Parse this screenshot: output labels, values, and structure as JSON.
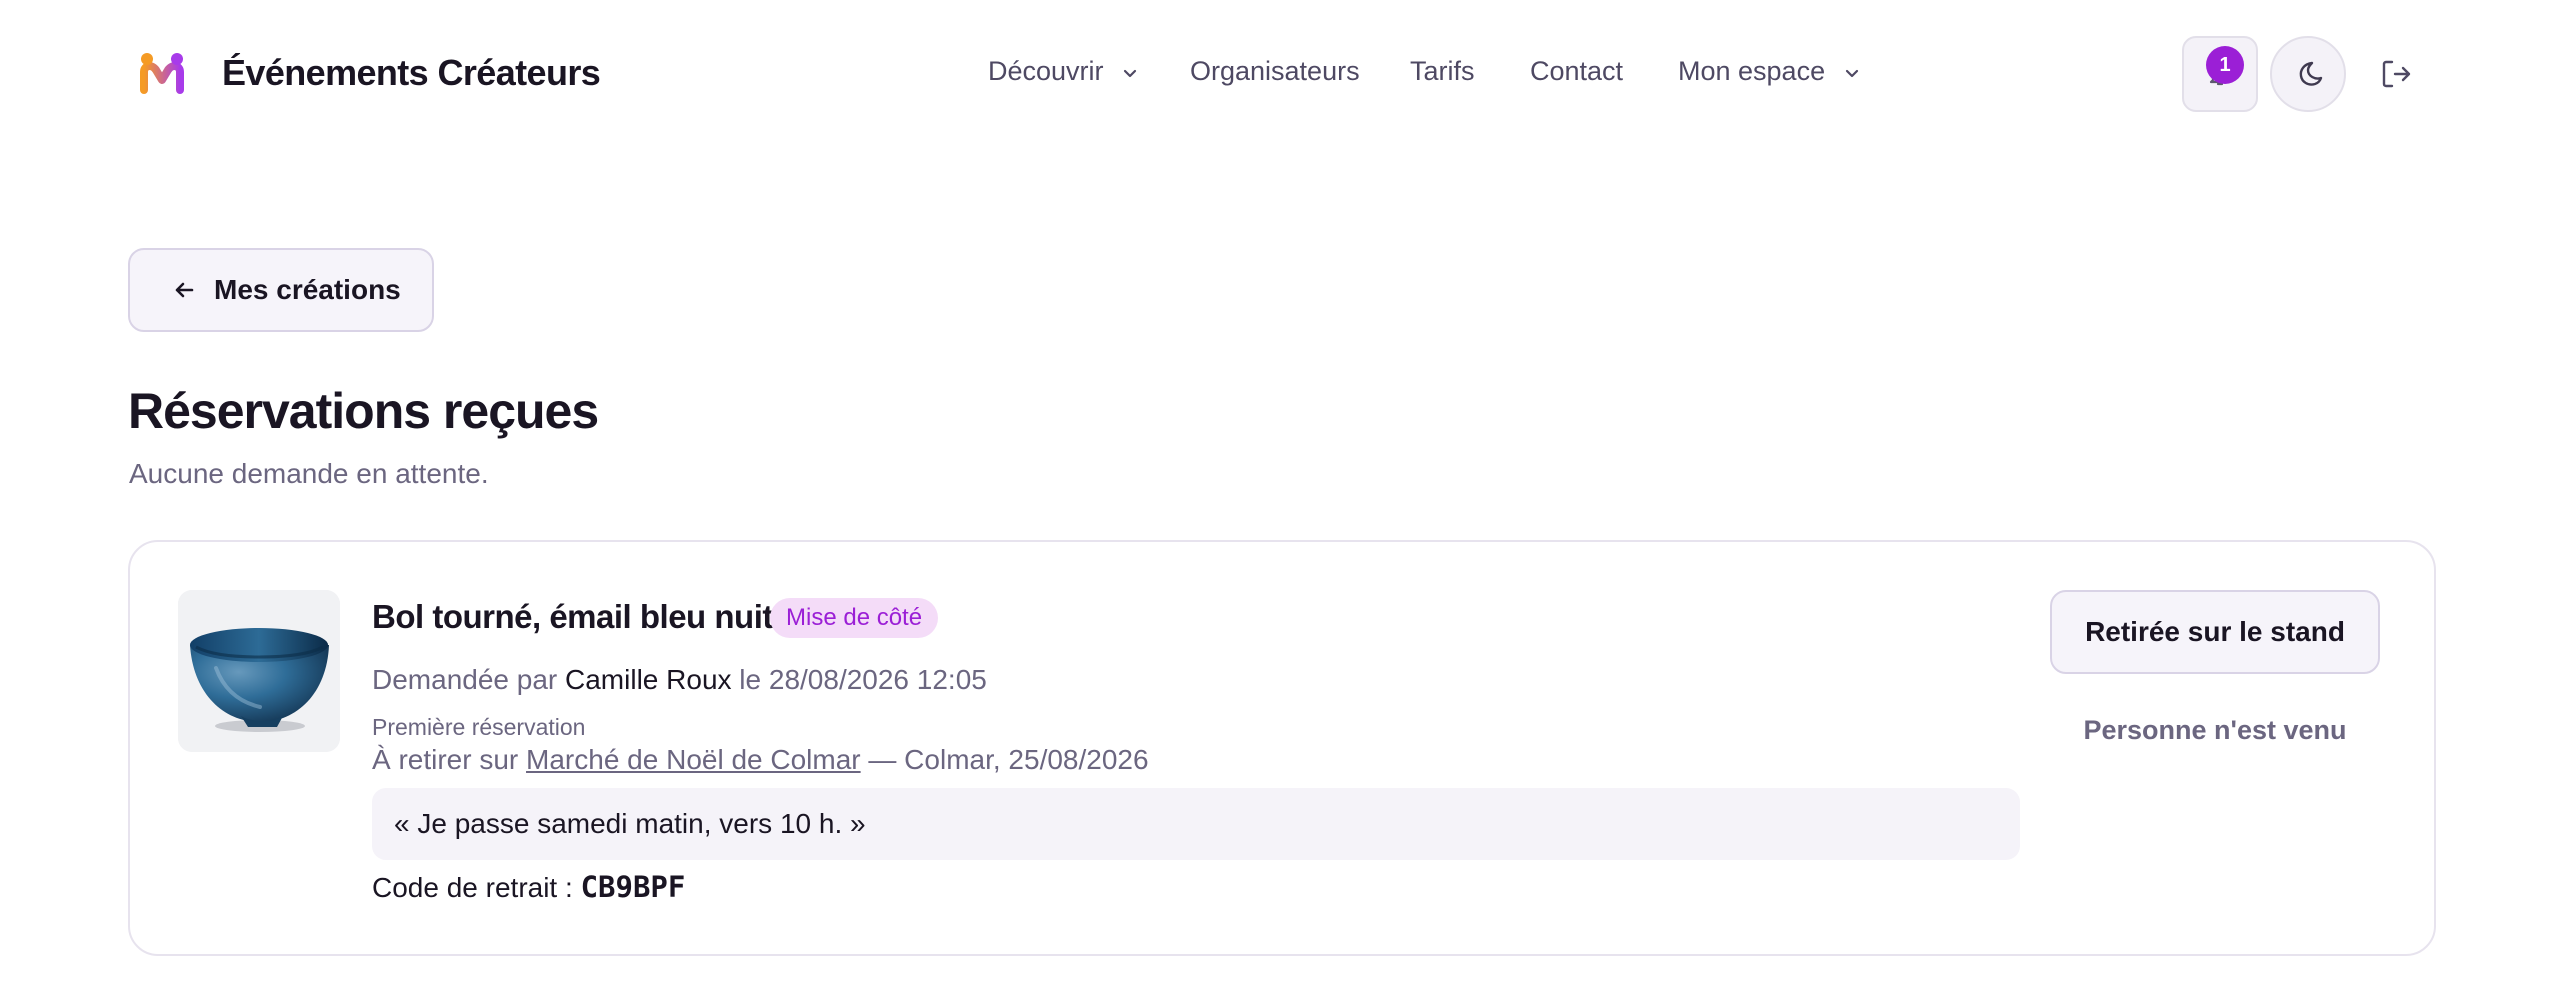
{
  "header": {
    "brand": "Événements Créateurs",
    "nav": {
      "discover": "Découvrir",
      "organizers": "Organisateurs",
      "pricing": "Tarifs",
      "contact": "Contact",
      "my_space": "Mon espace"
    },
    "notifications_count": "1",
    "icons": [
      "logo-icon",
      "bell-icon",
      "moon-icon",
      "logout-icon",
      "chevron-down-icon"
    ]
  },
  "back_button": {
    "label": "Mes créations"
  },
  "page": {
    "title": "Réservations reçues",
    "subtitle": "Aucune demande en attente."
  },
  "reservation": {
    "title": "Bol tourné, émail bleu nuit",
    "status": "Mise de côté",
    "requested_prefix": "Demandée par",
    "customer": "Camille Roux",
    "requested_suffix": "le 28/08/2026 12:05",
    "note": "Première réservation",
    "pickup_prefix": "À retirer sur",
    "market": "Marché de Noël de Colmar",
    "pickup_suffix": "— Colmar, 25/08/2026",
    "message": "« Je passe samedi matin, vers 10 h. »",
    "code_label": "Code de retrait :",
    "code": "CB9BPF",
    "primary_action": "Retirée sur le stand",
    "secondary_action": "Personne n'est venu"
  },
  "colors": {
    "accent": "#9b1fd6",
    "text": "#1a1523",
    "muted": "#6b6680"
  }
}
